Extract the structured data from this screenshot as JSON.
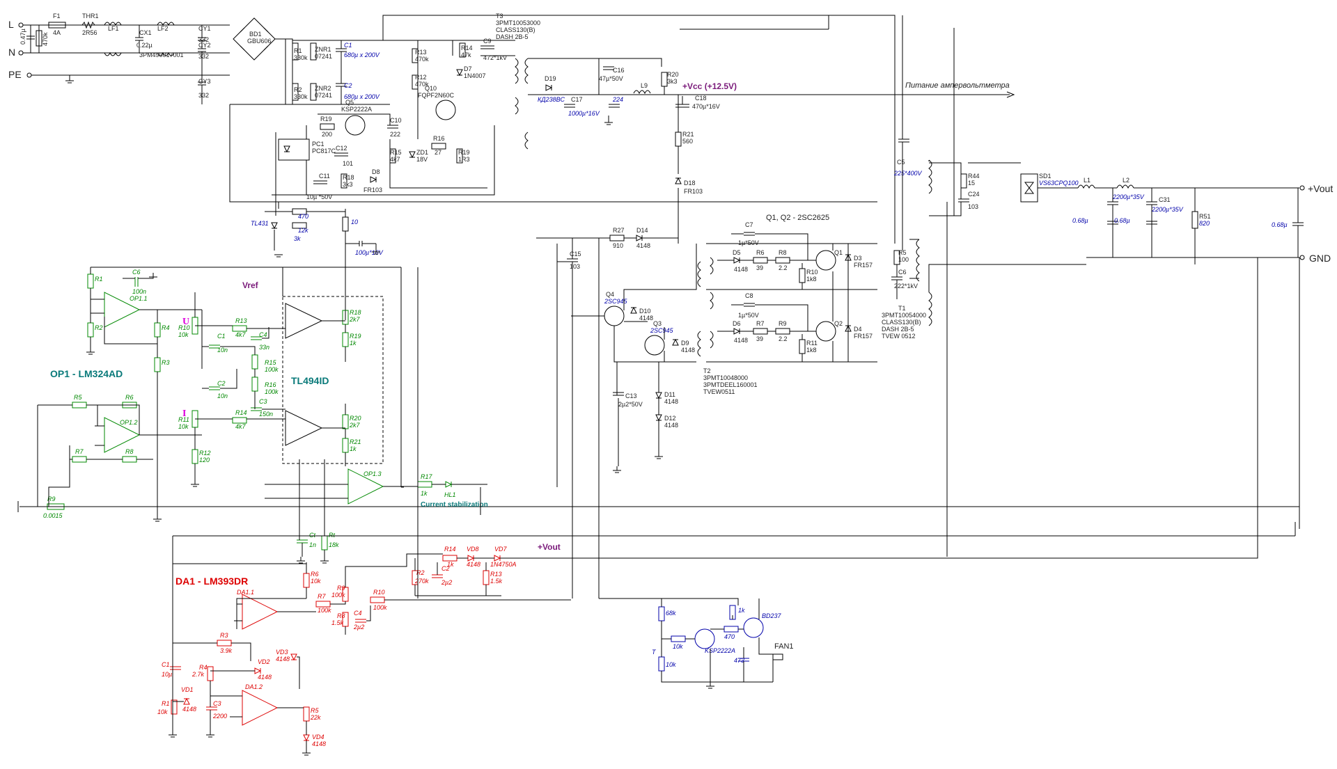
{
  "terminals": {
    "l": "L",
    "n": "N",
    "pe": "PE",
    "vout_pos": "+Vout",
    "gnd": "GND"
  },
  "headers": {
    "op1": "OP1 - LM324AD",
    "da1": "DA1 - LM393DR",
    "tl494": "TL494ID",
    "vref": "Vref",
    "vcc": "+Vcc (+12.5V)",
    "vout": "+Vout",
    "ammeter": "Питание ампервольтметра",
    "q1q2": "Q1, Q2 - 2SC2625",
    "u_label": "U",
    "i_label": "I",
    "current_stab": "Current stabilization"
  },
  "input_section": {
    "f1": "F1",
    "f1_val": "4A",
    "thr1": "THR1",
    "thr1_val": "2R56",
    "lf1": "LF1",
    "cx1": "CX1",
    "cx1_val": "0.22µ",
    "lf2": "LF2",
    "lf2_val": "3PM490017001",
    "cy1": "CY1",
    "cy1_val": "332",
    "cy2": "CY2",
    "cy2_val": "332",
    "cy3": "CY3",
    "cy3_val": "332",
    "cap_in": "0.47µ",
    "res_in": "470k",
    "bd1": "BD1",
    "bd1_val": "GBU606"
  },
  "primary": {
    "r1": "R1",
    "r1_val": "330k",
    "r2": "R2",
    "r2_val": "330k",
    "znr1": "ZNR1",
    "znr1_val": "07241",
    "znr2": "ZNR2",
    "znr2_val": "07241",
    "c1": "C1",
    "c1_val": "680µ x 200V",
    "c2": "C2",
    "c2_val": "680µ x 200V",
    "r13": "R13",
    "r13_val": "470k",
    "r12": "R12",
    "r12_val": "470k",
    "r14": "R14",
    "r14_val": "47k",
    "c9": "C9",
    "c9_val": "472*1kV",
    "d7": "D7",
    "d7_val": "1N4007",
    "q10": "Q10",
    "q10_val": "FQPF2N60C",
    "q5": "Q5",
    "q5_val": "KSP2222A",
    "r19": "R19",
    "r19_val": "200",
    "c10": "C10",
    "c10_val": "222",
    "r16": "R16",
    "r16_val": "27",
    "r15": "R15",
    "r15_val": "4k7",
    "zd1": "ZD1",
    "zd1_val": "18V",
    "r19b": "R19",
    "r19b_val": "1R3",
    "pc1": "PC1",
    "pc1_val": "PC817C",
    "c12": "C12",
    "c12_val": "101",
    "r18": "R18",
    "r18_val": "3k3",
    "d8": "D8",
    "d8_val": "FR103",
    "c11": "C11",
    "c11_val": "10µ *50V",
    "tl431": "TL431",
    "r470": "470",
    "r12k": "12k",
    "r3k": "3k",
    "r10": "10",
    "c100": "100µ*16V"
  },
  "t3": {
    "name": "T3",
    "part": "3PMT10053000",
    "class": "CLASS130(B)",
    "dash": "DASH 2B-5"
  },
  "aux": {
    "d19": "D19",
    "d19_val": "КД238ВС",
    "c17": "C17",
    "c17_val": "1000µ*16V",
    "c224": "224",
    "c16": "C16",
    "c16_val": "47µ*50V",
    "l9": "L9",
    "r20": "R20",
    "r20_val": "3k3",
    "c18": "C18",
    "c18_val": "470µ*16V",
    "r21": "R21",
    "r21_val": "560",
    "d18": "D18",
    "d18_val": "FR103"
  },
  "drive": {
    "r27": "R27",
    "r27_val": "910",
    "d14": "D14",
    "d14_val": "4148",
    "c15": "C15",
    "c15_val": "103",
    "q4": "Q4",
    "q4_val": "2SC945",
    "q3": "Q3",
    "q3_val": "2SC945",
    "d10": "D10",
    "d10_val": "4148",
    "d9": "D9",
    "d9_val": "4148",
    "c13": "C13",
    "c13_val": "2µ2*50V",
    "d11": "D11",
    "d11_val": "4148",
    "d12": "D12",
    "d12_val": "4148",
    "c7": "C7",
    "c7_val": "1µ*50V",
    "c8": "C8",
    "c8_val": "1µ*50V",
    "d5": "D5",
    "d5_val": "4148",
    "d6": "D6",
    "d6_val": "4148",
    "r6": "R6",
    "r6_val": "39",
    "r7": "R7",
    "r7_val": "39",
    "r8": "R8",
    "r8_val": "2.2",
    "r9": "R9",
    "r9_val": "2.2",
    "r10": "R10",
    "r10_val": "1k8",
    "r11": "R11",
    "r11_val": "1k8",
    "q1": "Q1",
    "q2": "Q2",
    "d3": "D3",
    "d3_val": "FR157",
    "d4": "D4",
    "d4_val": "FR157",
    "t2": "T2",
    "t2_part": "3PMT10048000",
    "t2_p2": "3PMTDEEL160001",
    "t2_p3": "TVEW0511"
  },
  "output": {
    "c5": "C5",
    "c5_val": "225*400V",
    "r5": "R5",
    "r5_val": "100",
    "c6": "C6",
    "c6_val": "222*1kV",
    "t1": "T1",
    "t1_part": "3PMT10054000",
    "t1_class": "CLASS130(B)",
    "t1_dash": "DASH 2B-5",
    "t1_tv": "TVEW 0512",
    "r44": "R44",
    "r44_val": "15",
    "c24": "C24",
    "c24_val": "103",
    "sd1": "SD1",
    "sd1_val": "VS63CPQ100",
    "l1": "L1",
    "l2": "L2",
    "c_out1": "2200µ*35V",
    "c31": "C31",
    "c31_val": "2200µ*35V",
    "c_068a": "0.68µ",
    "c_068b": "0.68µ",
    "c_068c": "0.68µ",
    "r51": "R51",
    "r51_val": "820"
  },
  "control": {
    "r1": "R1",
    "r2": "R2",
    "c6": "C6",
    "c6_val": "100n",
    "op11": "OP1.1",
    "r4": "R4",
    "r3": "R3",
    "r5": "R5",
    "r6": "R6",
    "op12": "OP1.2",
    "r7": "R7",
    "r8": "R8",
    "r9": "R9",
    "r9_val": "0.0015",
    "r10": "R10",
    "r10_val": "10k",
    "r11": "R11",
    "r11_val": "10k",
    "r12": "R12",
    "r12_val": "120",
    "r13": "R13",
    "r13_val": "4k7",
    "r14": "R14",
    "r14_val": "4k7",
    "c1": "C1",
    "c1_val": "10n",
    "c2": "C2",
    "c2_val": "10n",
    "c4": "C4",
    "c4_val": "33n",
    "c3": "C3",
    "c3_val": "150n",
    "r15": "R15",
    "r15_val": "100k",
    "r16": "R16",
    "r16_val": "100k",
    "r18": "R18",
    "r18_val": "2k7",
    "r19": "R19",
    "r19_val": "1k",
    "r20": "R20",
    "r20_val": "2k7",
    "r21": "R21",
    "r21_val": "1k",
    "op13": "OP1.3",
    "r17": "R17",
    "r17_val": "1k",
    "hl1": "HL1",
    "ct": "Ct",
    "ct_val": "1n",
    "rt": "Rt",
    "rt_val": "18k"
  },
  "comparator": {
    "r6": "R6",
    "r6_val": "10k",
    "da11": "DA1.1",
    "da12": "DA1.2",
    "r7": "R7",
    "r7_val": "100k",
    "r9": "R9",
    "r9_val": "100k",
    "r8": "R8",
    "r8_val": "1.5k",
    "c4": "C4",
    "c4_val": "2µ2",
    "r10": "R10",
    "r10_val": "100k",
    "r3": "R3",
    "r3_val": "3.9k",
    "vd2": "VD2",
    "vd2_val": "4148",
    "vd3": "VD3",
    "vd3_val": "4148",
    "r4": "R4",
    "r4_val": "2.7k",
    "c1": "C1",
    "c1_val": "10µ",
    "vd1": "VD1",
    "vd1_val": "4148",
    "r1": "R1",
    "r1_val": "10k",
    "c3": "C3",
    "c3_val": "2200",
    "r5": "R5",
    "r5_val": "22k",
    "vd4": "VD4",
    "vd4_val": "4148",
    "r14": "R14",
    "r14_val": "1k",
    "vd8": "VD8",
    "vd8_val": "4148",
    "vd7": "VD7",
    "vd7_val": "1N4750A",
    "r2": "R2",
    "r2_val": "270k",
    "c2": "C2",
    "c2_val": "2µ2",
    "r13": "R13",
    "r13_val": "1.5k"
  },
  "fan": {
    "r68k": "68k",
    "r10k": "10k",
    "r10kb": "10k",
    "t": "T",
    "r1k": "1k",
    "r470": "470",
    "q_ksp": "KSP2222A",
    "q_bd": "BD237",
    "c473": "473",
    "fan1": "FAN1"
  }
}
